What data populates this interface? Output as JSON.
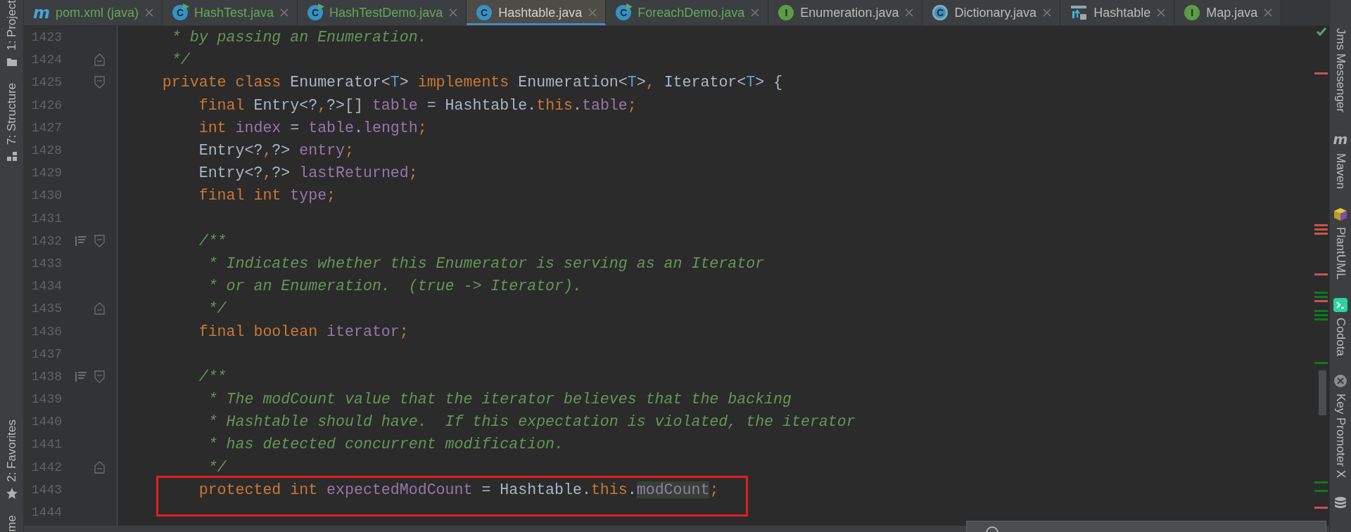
{
  "tabs": [
    {
      "label": "pom.xml (java)",
      "kind": "maven",
      "badge": "m",
      "color": "#62a85a",
      "selected": false
    },
    {
      "label": "HashTest.java",
      "kind": "runnable",
      "badge": "C",
      "color": "#62a85a",
      "selected": false
    },
    {
      "label": "HashTestDemo.java",
      "kind": "runnable",
      "badge": "C",
      "color": "#62a85a",
      "selected": false
    },
    {
      "label": "Hashtable.java",
      "kind": "class",
      "badge": "C",
      "color": "#d0d0d0",
      "selected": true
    },
    {
      "label": "ForeachDemo.java",
      "kind": "runnable",
      "badge": "C",
      "color": "#62a85a",
      "selected": false
    },
    {
      "label": "Enumeration.java",
      "kind": "interface",
      "badge": "I",
      "color": "#bbbbbb",
      "selected": false
    },
    {
      "label": "Dictionary.java",
      "kind": "abstract",
      "badge": "C",
      "color": "#bbbbbb",
      "selected": false
    },
    {
      "label": "Hashtable",
      "kind": "diagram",
      "color": "#bbbbbb",
      "selected": false
    },
    {
      "label": "Map.java",
      "kind": "interface",
      "badge": "I",
      "color": "#bbbbbb",
      "selected": false
    }
  ],
  "left_toolbar_top": [
    {
      "label": "1: Project",
      "kind": "folder"
    },
    {
      "label": "7: Structure",
      "kind": "structure"
    }
  ],
  "left_toolbar_bottom": [
    {
      "label": "2: Favorites",
      "kind": "star"
    },
    {
      "label": "me",
      "kind": "plain"
    }
  ],
  "right_toolbar": [
    {
      "label": "Jms Messenger",
      "kind": "plain"
    },
    {
      "label": "Maven",
      "kind": "maven",
      "badge": "m"
    },
    {
      "label": "PlantUML",
      "kind": "cube"
    },
    {
      "label": "Codota",
      "kind": "terminal"
    },
    {
      "label": "Key Promoter X",
      "kind": "x-circle"
    },
    {
      "kind": "database"
    }
  ],
  "editor": {
    "lines": [
      {
        "number": "1423",
        "tokens": [
          {
            "t": "     * by passing an Enumeration.",
            "kind": "comment"
          }
        ]
      },
      {
        "number": "1424",
        "fold_end": true,
        "tokens": [
          {
            "t": "     */",
            "kind": "comment"
          }
        ]
      },
      {
        "number": "1425",
        "fold_start": true,
        "tokens": [
          {
            "t": "    private class ",
            "kind": "kw"
          },
          {
            "t": "Enumerator<",
            "kind": "plain"
          },
          {
            "t": "T",
            "kind": "tparam"
          },
          {
            "t": "> ",
            "kind": "plain"
          },
          {
            "t": "implements ",
            "kind": "kw"
          },
          {
            "t": "Enumeration<",
            "kind": "plain"
          },
          {
            "t": "T",
            "kind": "tparam"
          },
          {
            "t": ">",
            "kind": "plain"
          },
          {
            "t": ",",
            "kind": "kw"
          },
          {
            "t": " Iterator<",
            "kind": "plain"
          },
          {
            "t": "T",
            "kind": "tparam"
          },
          {
            "t": "> {",
            "kind": "plain"
          }
        ]
      },
      {
        "number": "1426",
        "tokens": [
          {
            "t": "        final ",
            "kind": "kw"
          },
          {
            "t": "Entry<?",
            "kind": "plain"
          },
          {
            "t": ",",
            "kind": "kw"
          },
          {
            "t": "?>[] ",
            "kind": "plain"
          },
          {
            "t": "table",
            "kind": "field"
          },
          {
            "t": " = Hashtable.",
            "kind": "plain"
          },
          {
            "t": "this",
            "kind": "kw"
          },
          {
            "t": ".",
            "kind": "plain"
          },
          {
            "t": "table",
            "kind": "field"
          },
          {
            "t": ";",
            "kind": "kw"
          }
        ]
      },
      {
        "number": "1427",
        "tokens": [
          {
            "t": "        int ",
            "kind": "kw"
          },
          {
            "t": "index",
            "kind": "field"
          },
          {
            "t": " = ",
            "kind": "plain"
          },
          {
            "t": "table",
            "kind": "field"
          },
          {
            "t": ".",
            "kind": "plain"
          },
          {
            "t": "length",
            "kind": "field"
          },
          {
            "t": ";",
            "kind": "kw"
          }
        ]
      },
      {
        "number": "1428",
        "tokens": [
          {
            "t": "        Entry<?",
            "kind": "plain"
          },
          {
            "t": ",",
            "kind": "kw"
          },
          {
            "t": "?> ",
            "kind": "plain"
          },
          {
            "t": "entry",
            "kind": "field"
          },
          {
            "t": ";",
            "kind": "kw"
          }
        ]
      },
      {
        "number": "1429",
        "tokens": [
          {
            "t": "        Entry<?",
            "kind": "plain"
          },
          {
            "t": ",",
            "kind": "kw"
          },
          {
            "t": "?> ",
            "kind": "plain"
          },
          {
            "t": "lastReturned",
            "kind": "field"
          },
          {
            "t": ";",
            "kind": "kw"
          }
        ]
      },
      {
        "number": "1430",
        "tokens": [
          {
            "t": "        final int ",
            "kind": "kw"
          },
          {
            "t": "type",
            "kind": "field"
          },
          {
            "t": ";",
            "kind": "kw"
          }
        ]
      },
      {
        "number": "1431"
      },
      {
        "number": "1432",
        "fold_start": true,
        "doc_toggle": true,
        "tokens": [
          {
            "t": "        /**",
            "kind": "comment"
          }
        ]
      },
      {
        "number": "1433",
        "tokens": [
          {
            "t": "         * Indicates whether this Enumerator is serving as an Iterator",
            "kind": "comment"
          }
        ]
      },
      {
        "number": "1434",
        "tokens": [
          {
            "t": "         * or an Enumeration.  (true -> Iterator).",
            "kind": "comment"
          }
        ]
      },
      {
        "number": "1435",
        "fold_end": true,
        "tokens": [
          {
            "t": "         */",
            "kind": "comment"
          }
        ]
      },
      {
        "number": "1436",
        "tokens": [
          {
            "t": "        final boolean ",
            "kind": "kw"
          },
          {
            "t": "iterator",
            "kind": "field"
          },
          {
            "t": ";",
            "kind": "kw"
          }
        ]
      },
      {
        "number": "1437"
      },
      {
        "number": "1438",
        "fold_start": true,
        "doc_toggle": true,
        "tokens": [
          {
            "t": "        /**",
            "kind": "comment"
          }
        ]
      },
      {
        "number": "1439",
        "tokens": [
          {
            "t": "         * The modCount value that the iterator believes that the backing",
            "kind": "comment"
          }
        ]
      },
      {
        "number": "1440",
        "tokens": [
          {
            "t": "         * Hashtable should have.  If this expectation is violated, the iterator",
            "kind": "comment"
          }
        ]
      },
      {
        "number": "1441",
        "tokens": [
          {
            "t": "         * has detected concurrent modification.",
            "kind": "comment"
          }
        ]
      },
      {
        "number": "1442",
        "fold_end": true,
        "tokens": [
          {
            "t": "         */",
            "kind": "comment"
          }
        ]
      },
      {
        "number": "1443",
        "boxed": true,
        "tokens": [
          {
            "t": "        protected int ",
            "kind": "kw"
          },
          {
            "t": "expectedModCount",
            "kind": "field"
          },
          {
            "t": " = Hashtable.",
            "kind": "plain"
          },
          {
            "t": "this",
            "kind": "kw"
          },
          {
            "t": ".",
            "kind": "plain"
          },
          {
            "t": "modCount",
            "kind": "field",
            "highlighted": true
          },
          {
            "t": ";",
            "kind": "kw"
          }
        ]
      },
      {
        "number": "1444"
      }
    ]
  }
}
